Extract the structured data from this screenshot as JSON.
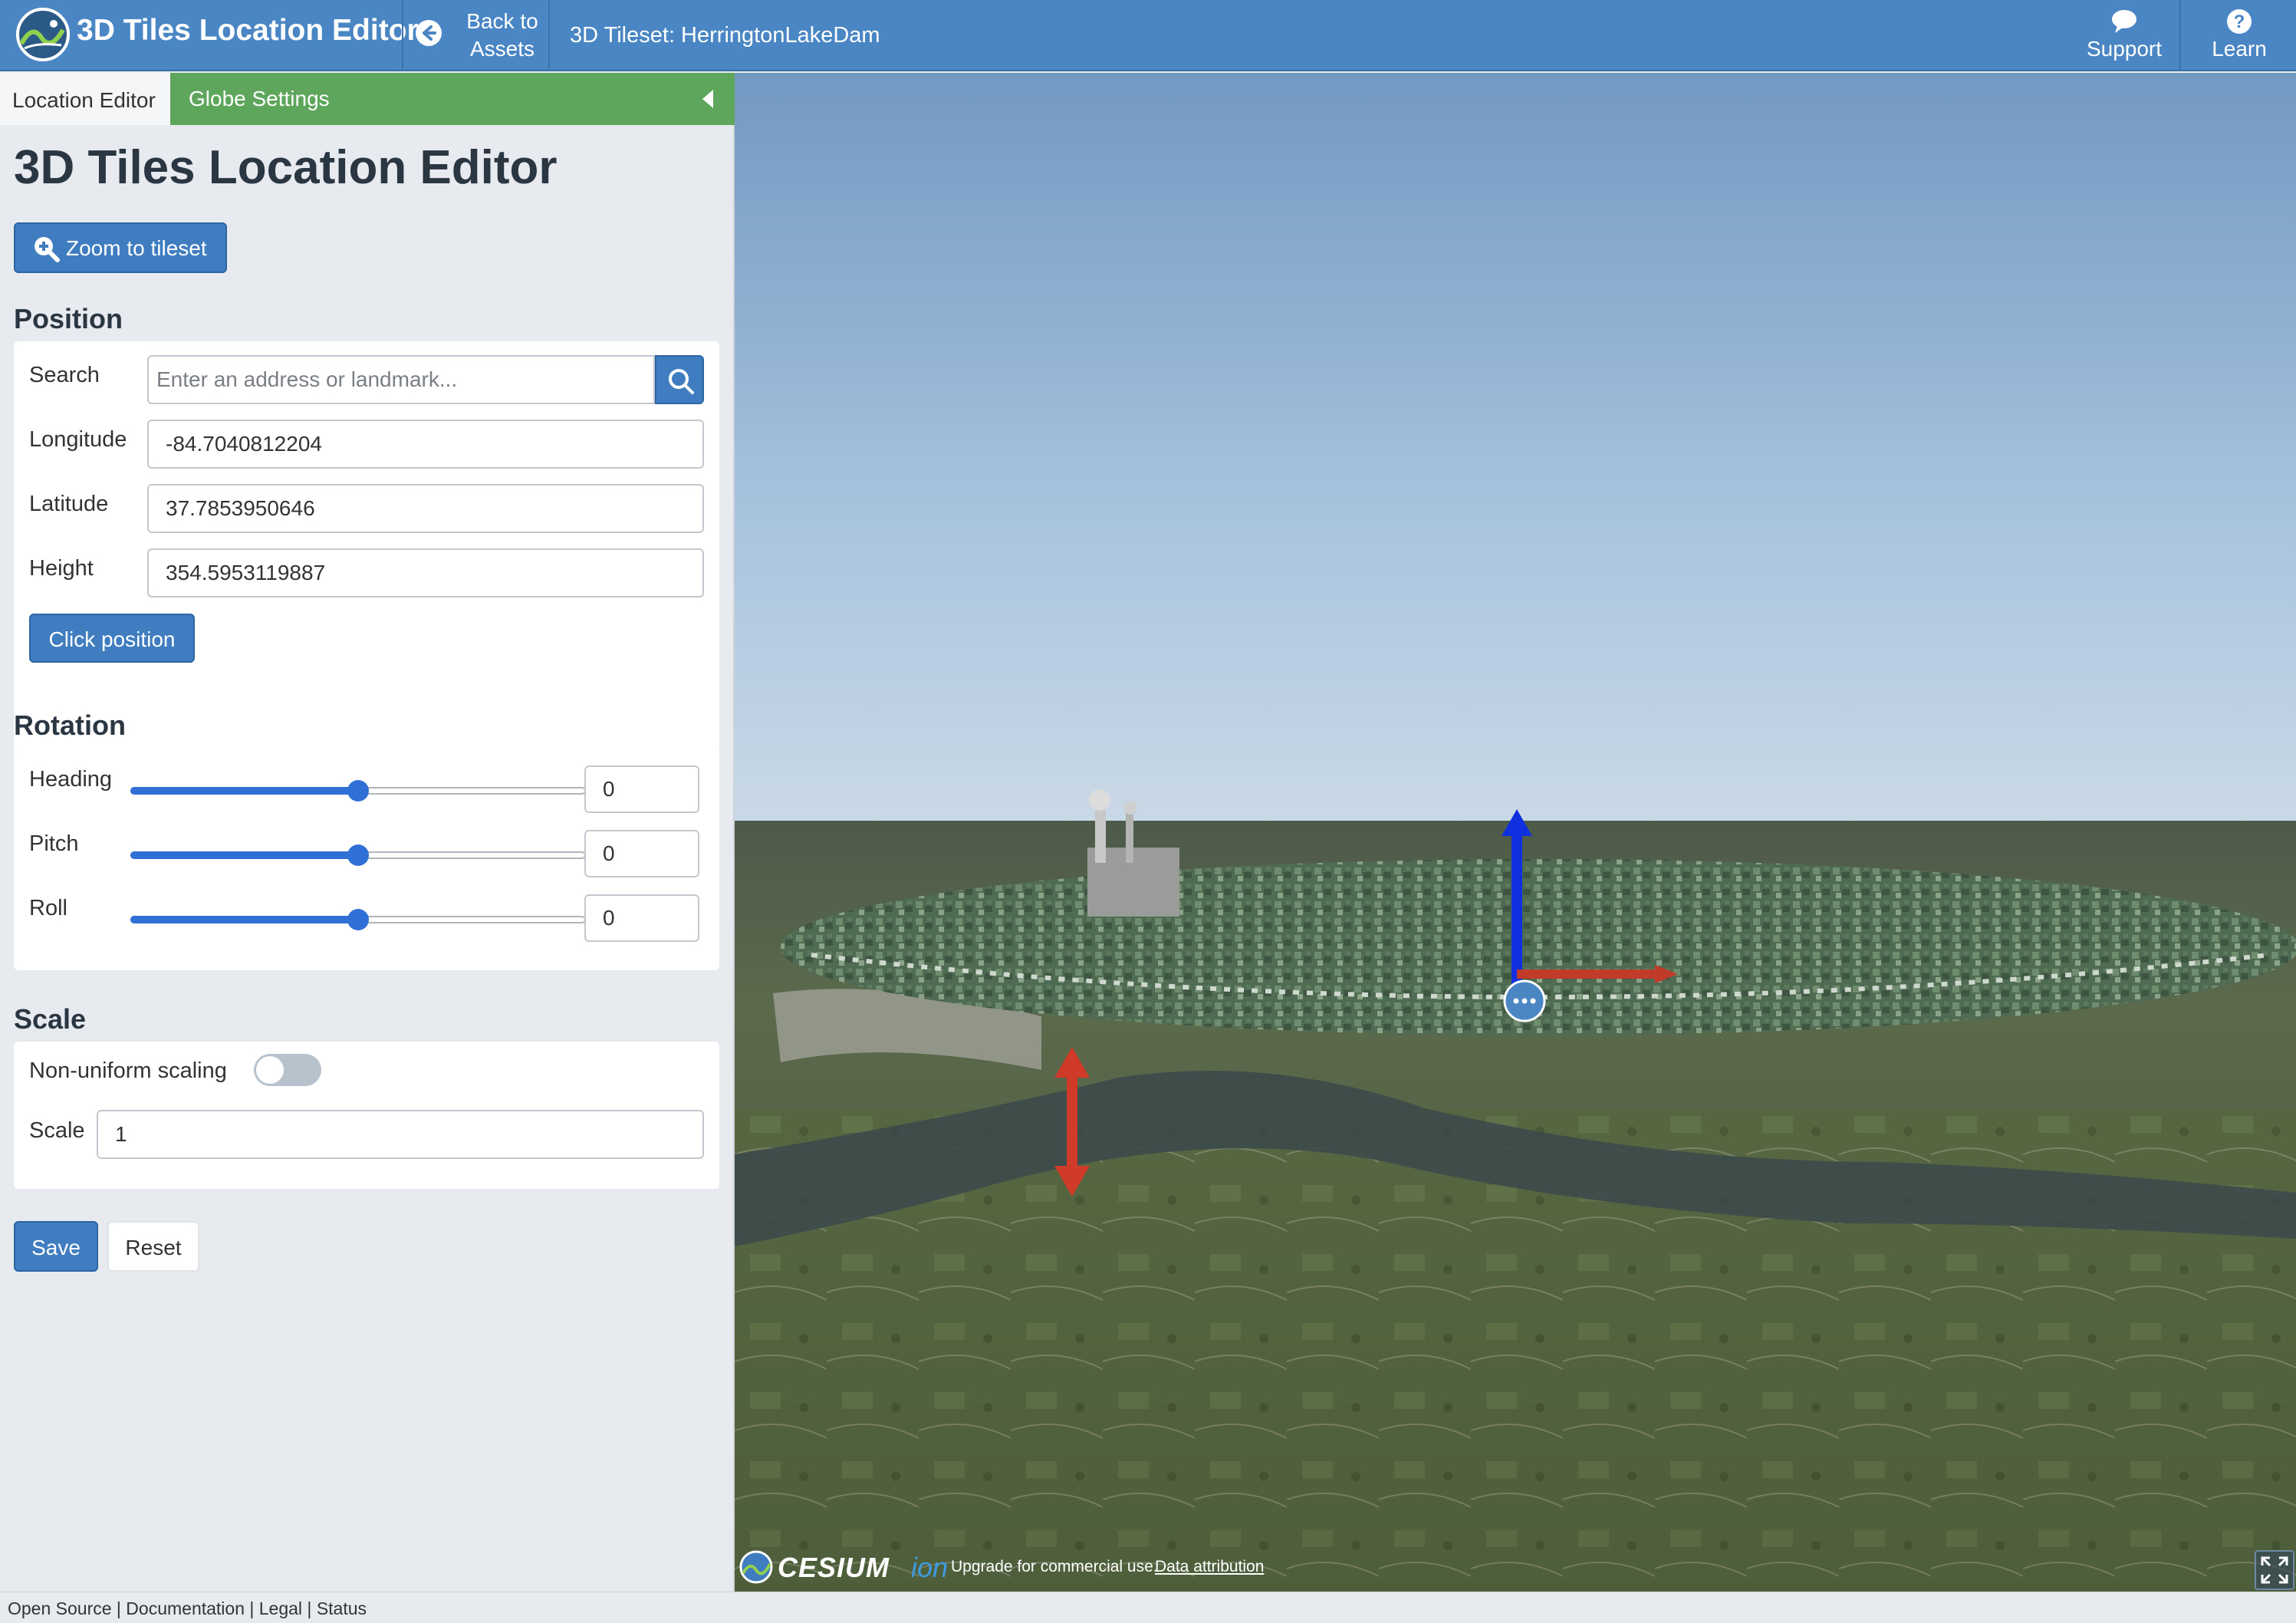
{
  "header": {
    "app_title": "3D Tiles Location Editor",
    "back_label_line1": "Back to",
    "back_label_line2": "Assets",
    "tileset_label": "3D Tileset: HerringtonLakeDam",
    "support_label": "Support",
    "learn_label": "Learn",
    "bg_color": "#4a86c3"
  },
  "sidebar": {
    "tabs": [
      {
        "label": "Location Editor",
        "active": true
      },
      {
        "label": "Globe Settings",
        "active": false
      }
    ],
    "panel_title": "3D Tiles Location Editor",
    "zoom_button": "Zoom to tileset",
    "position": {
      "heading": "Position",
      "search_label": "Search",
      "search_placeholder": "Enter an address or landmark...",
      "longitude_label": "Longitude",
      "longitude_value": "-84.7040812204",
      "latitude_label": "Latitude",
      "latitude_value": "37.7853950646",
      "height_label": "Height",
      "height_value": "354.5953119887",
      "click_position_button": "Click position"
    },
    "rotation": {
      "heading": "Rotation",
      "sliders": [
        {
          "label": "Heading",
          "value": "0",
          "fraction": 0.5
        },
        {
          "label": "Pitch",
          "value": "0",
          "fraction": 0.5
        },
        {
          "label": "Roll",
          "value": "0",
          "fraction": 0.5
        }
      ]
    },
    "scale": {
      "heading": "Scale",
      "nonuniform_label": "Non-uniform scaling",
      "nonuniform_on": false,
      "scale_label": "Scale",
      "scale_value": "1"
    },
    "save_button": "Save",
    "reset_button": "Reset",
    "accent_color": "#3f7dc0",
    "globe_tab_color": "#5da65b"
  },
  "viewport": {
    "cesium_name": "CESIUM",
    "cesium_ion": "ion",
    "upgrade_text": "Upgrade for commercial use.",
    "attribution_link": "Data attribution"
  },
  "footer": {
    "links": [
      "Open Source",
      "Documentation",
      "Legal",
      "Status"
    ]
  }
}
